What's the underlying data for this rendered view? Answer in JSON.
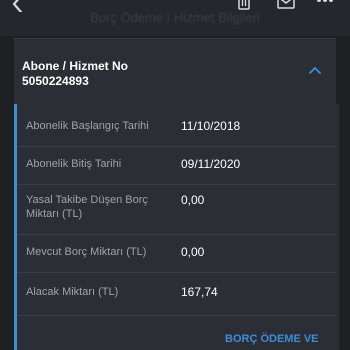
{
  "header": {
    "title": "Borç Ödeme / Hizmet Bilgileri",
    "back_icon": "chevron-left-icon",
    "actions": [
      "trash-icon",
      "mail-icon",
      "more-icon"
    ]
  },
  "subscription": {
    "label": "Abone / Hizmet No",
    "number": "5050224893",
    "toggle_icon": "chevron-up-icon"
  },
  "details": [
    {
      "label": "Abonelik Başlangıç Tarihi",
      "value": "11/10/2018"
    },
    {
      "label": "Abonelik Bitiş Tarihi",
      "value": "09/11/2020"
    },
    {
      "label": "Yasal Takibe Düşen Borç Miktarı (TL)",
      "value": "0,00"
    },
    {
      "label": "Mevcut Borç Miktarı (TL)",
      "value": "0,00"
    },
    {
      "label": "Alacak Miktarı (TL)",
      "value": "167,74"
    }
  ],
  "action": {
    "label": "BORÇ ÖDEME VE"
  },
  "colors": {
    "background": "#1e2024",
    "card": "#2b2e34",
    "accent": "#3d8ed6",
    "label": "#9fa3aa",
    "value": "#ffffff"
  }
}
